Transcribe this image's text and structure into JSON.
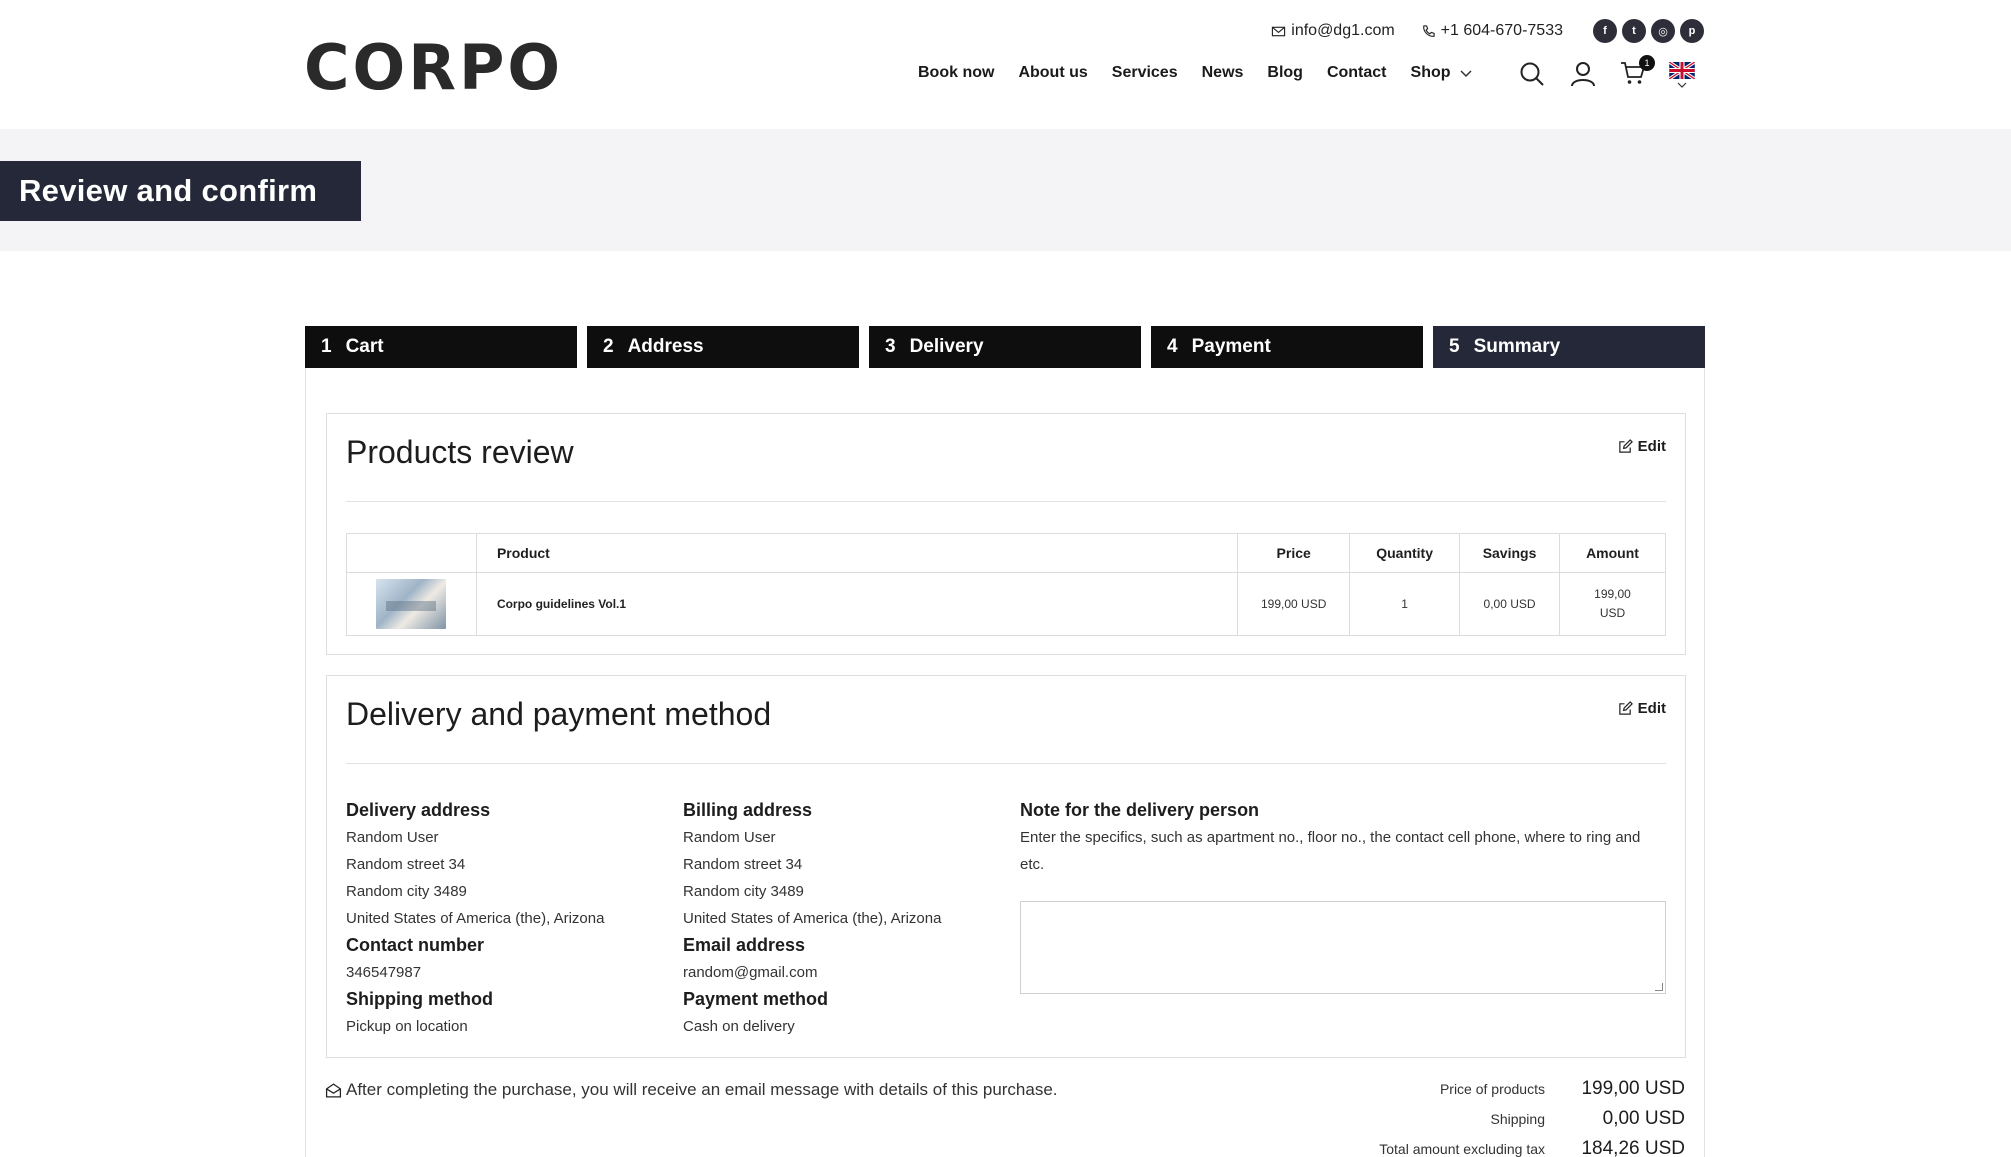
{
  "brand": {
    "logo_text": "CORPO"
  },
  "topbar": {
    "email": "info@dg1.com",
    "phone": "+1 604-670-7533",
    "socials": [
      "facebook-icon",
      "twitter-icon",
      "instagram-icon",
      "pinterest-icon"
    ]
  },
  "nav": {
    "items": [
      "Book now",
      "About us",
      "Services",
      "News",
      "Blog",
      "Contact",
      "Shop"
    ],
    "cart_count": "1",
    "language": "English (UK flag)"
  },
  "page": {
    "title": "Review and confirm"
  },
  "steps": [
    {
      "num": "1",
      "label": "Cart"
    },
    {
      "num": "2",
      "label": "Address"
    },
    {
      "num": "3",
      "label": "Delivery"
    },
    {
      "num": "4",
      "label": "Payment"
    },
    {
      "num": "5",
      "label": "Summary",
      "active": true
    }
  ],
  "products_review": {
    "title": "Products review",
    "edit_label": "Edit",
    "columns": [
      "Product",
      "Price",
      "Quantity",
      "Savings",
      "Amount"
    ],
    "rows": [
      {
        "product": "Corpo guidelines Vol.1",
        "price": "199,00 USD",
        "quantity": "1",
        "savings": "0,00 USD",
        "amount_line1": "199,00",
        "amount_line2": "USD"
      }
    ]
  },
  "delivery_payment": {
    "title": "Delivery and payment method",
    "edit_label": "Edit",
    "delivery_address": {
      "heading": "Delivery address",
      "lines": [
        "Random User",
        "Random street 34",
        "Random city 3489",
        "United States of America (the), Arizona"
      ]
    },
    "contact_number": {
      "heading": "Contact number",
      "value": "346547987"
    },
    "shipping_method": {
      "heading": "Shipping method",
      "value": "Pickup on location"
    },
    "billing_address": {
      "heading": "Billing address",
      "lines": [
        "Random User",
        "Random street 34",
        "Random city 3489",
        "United States of America (the), Arizona"
      ]
    },
    "email_address": {
      "heading": "Email address",
      "value": "random@gmail.com"
    },
    "payment_method": {
      "heading": "Payment method",
      "value": "Cash on delivery"
    },
    "note": {
      "heading": "Note for the delivery person",
      "text": "Enter the specifics, such as apartment no., floor no., the contact cell phone, where to ring and etc.",
      "value": ""
    }
  },
  "email_message": "After completing the purchase, you will receive an email message with details of this purchase.",
  "totals": [
    {
      "label": "Price of products",
      "value": "199,00 USD"
    },
    {
      "label": "Shipping",
      "value": "0,00 USD"
    },
    {
      "label": "Total amount excluding tax",
      "value": "184,26 USD"
    }
  ],
  "colors": {
    "dark_navy": "#252838",
    "step_black": "#0e0e0e",
    "band_gray": "#f4f4f6"
  }
}
